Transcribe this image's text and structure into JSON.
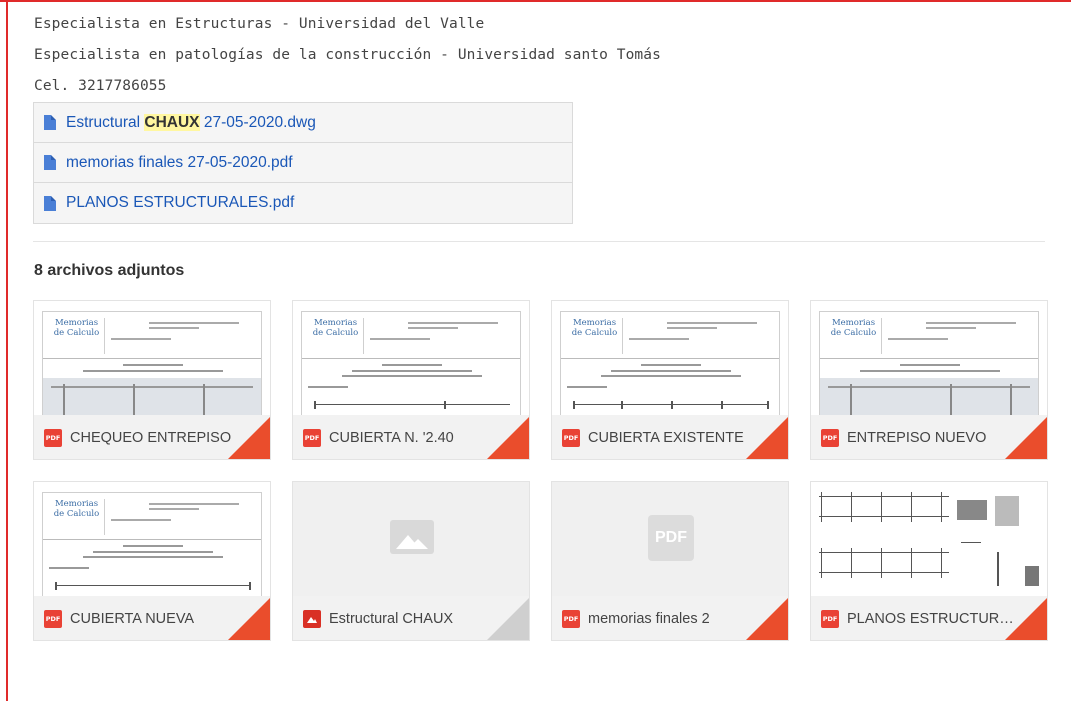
{
  "signature": {
    "line1": "Especialista en Estructuras - Universidad del Valle",
    "line2": "Especialista en patologías de la construcción - Universidad santo Tomás",
    "line3": "Cel. 3217786055"
  },
  "inline_attachments": [
    {
      "prefix": "Estructural ",
      "highlight": "CHAUX",
      "suffix": " 27-05-2020.dwg",
      "icon": "file-icon"
    },
    {
      "prefix": "memorias finales 27-05-2020.pdf",
      "highlight": "",
      "suffix": "",
      "icon": "file-icon"
    },
    {
      "prefix": "PLANOS ESTRUCTURALES.pdf",
      "highlight": "",
      "suffix": "",
      "icon": "file-icon"
    }
  ],
  "attachments_heading": "8 archivos adjuntos",
  "thumb_logo": {
    "line1": "Memorias",
    "line2": "de Calculo"
  },
  "attachments": [
    {
      "name": "CHEQUEO ENTREPISO ",
      "type": "pdf",
      "badge": "PDF"
    },
    {
      "name": "CUBIERTA N. '2.40 ",
      "type": "pdf",
      "badge": "PDF"
    },
    {
      "name": "CUBIERTA EXISTENTE ",
      "type": "pdf",
      "badge": "PDF"
    },
    {
      "name": "ENTREPISO NUEVO ",
      "type": "pdf",
      "badge": "PDF"
    },
    {
      "name": "CUBIERTA NUEVA ",
      "type": "pdf",
      "badge": "PDF"
    },
    {
      "name": "Estructural CHAUX ",
      "type": "image",
      "badge": ""
    },
    {
      "name": "memorias finales 2",
      "type": "pdf",
      "badge": "PDF"
    },
    {
      "name": "PLANOS ESTRUCTURALES",
      "type": "pdf",
      "badge": "PDF"
    }
  ],
  "placeholder_pdf_label": "PDF",
  "colors": {
    "frame": "#e02a2a",
    "link": "#1a57b7",
    "pdf_badge": "#e94235",
    "corner": "#ea4d2c"
  }
}
